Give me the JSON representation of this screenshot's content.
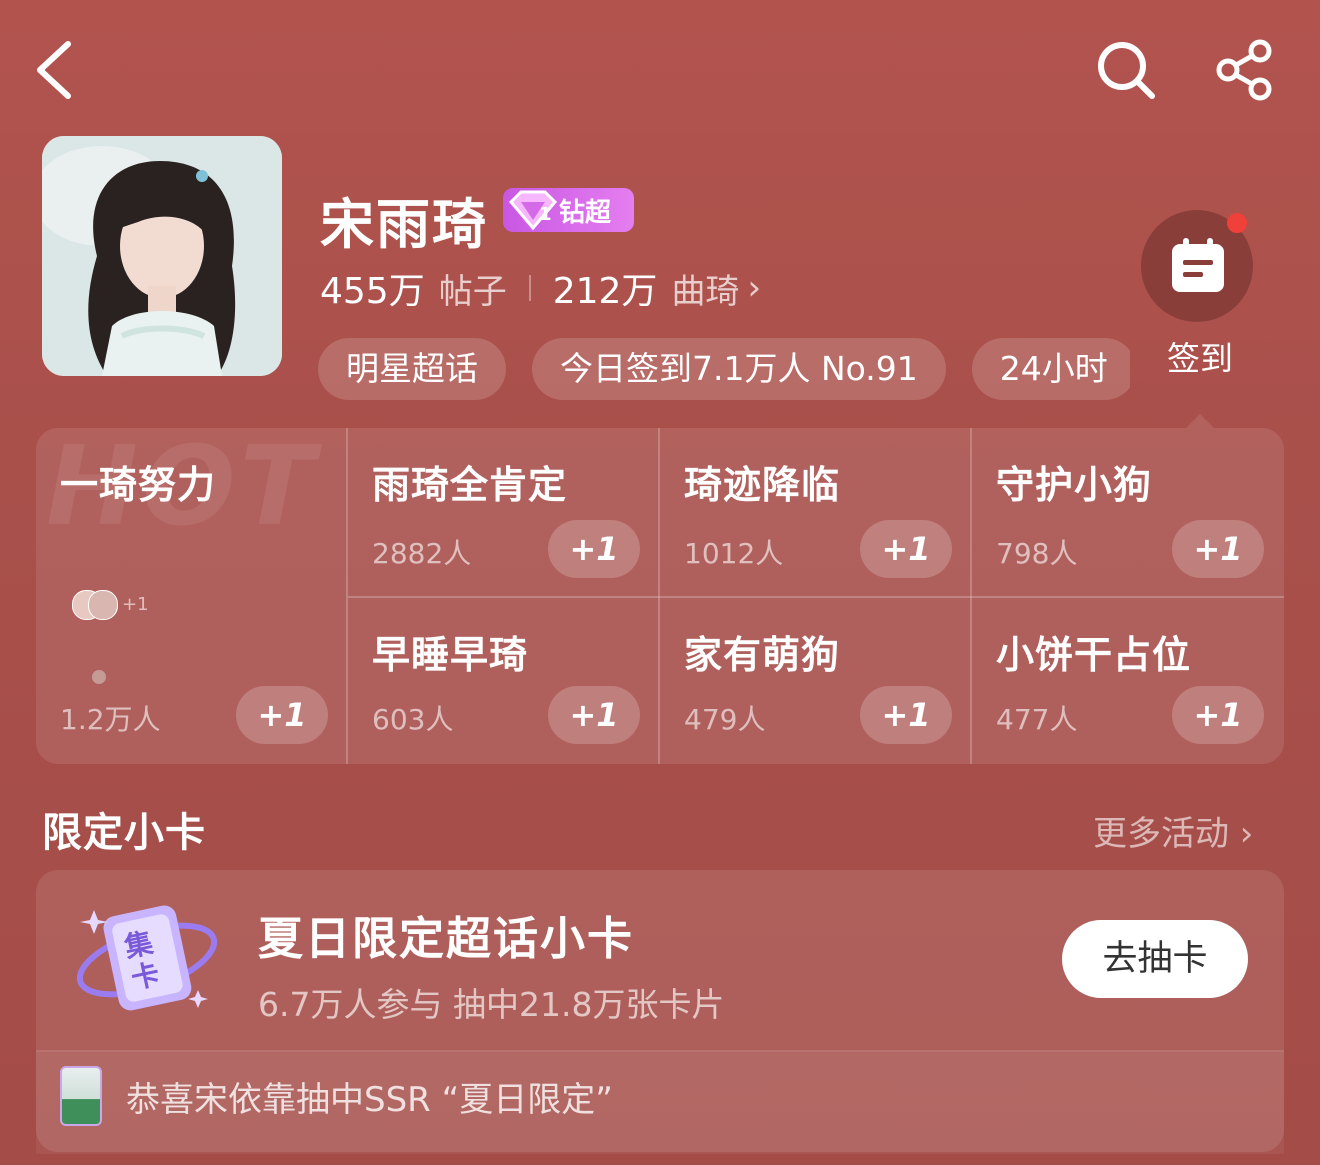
{
  "header": {
    "back_icon": "chevron-left-icon",
    "search_icon": "search-icon",
    "share_icon": "share-icon"
  },
  "profile": {
    "name": "宋雨琦",
    "badge_label": "钻超",
    "badge_level": "1",
    "posts_count": "455万",
    "posts_label": "帖子",
    "fans_count": "212万",
    "fans_label": "曲琦",
    "fans_arrow": "›",
    "tags": [
      "明星超话",
      "今日签到7.1万人 No.91",
      "24小时"
    ],
    "checkin_label": "签到"
  },
  "grid": {
    "hot_watermark": "HOT",
    "featured": {
      "name": "一琦努力",
      "count": "1.2万人",
      "avatar_plus": "+1",
      "plus": "+1"
    },
    "items": [
      {
        "name": "雨琦全肯定",
        "count": "2882人",
        "plus": "+1"
      },
      {
        "name": "琦迹降临",
        "count": "1012人",
        "plus": "+1"
      },
      {
        "name": "守护小狗",
        "count": "798人",
        "plus": "+1"
      },
      {
        "name": "早睡早琦",
        "count": "603人",
        "plus": "+1"
      },
      {
        "name": "家有萌狗",
        "count": "479人",
        "plus": "+1"
      },
      {
        "name": "小饼干占位",
        "count": "477人",
        "plus": "+1"
      }
    ]
  },
  "section": {
    "title": "限定小卡",
    "more": "更多活动 ›"
  },
  "card": {
    "icon_text": "集卡",
    "title": "夏日限定超话小卡",
    "subtitle": "6.7万人参与  抽中21.8万张卡片",
    "button": "去抽卡",
    "footer": "恭喜宋依靠抽中SSR “夏日限定”"
  }
}
